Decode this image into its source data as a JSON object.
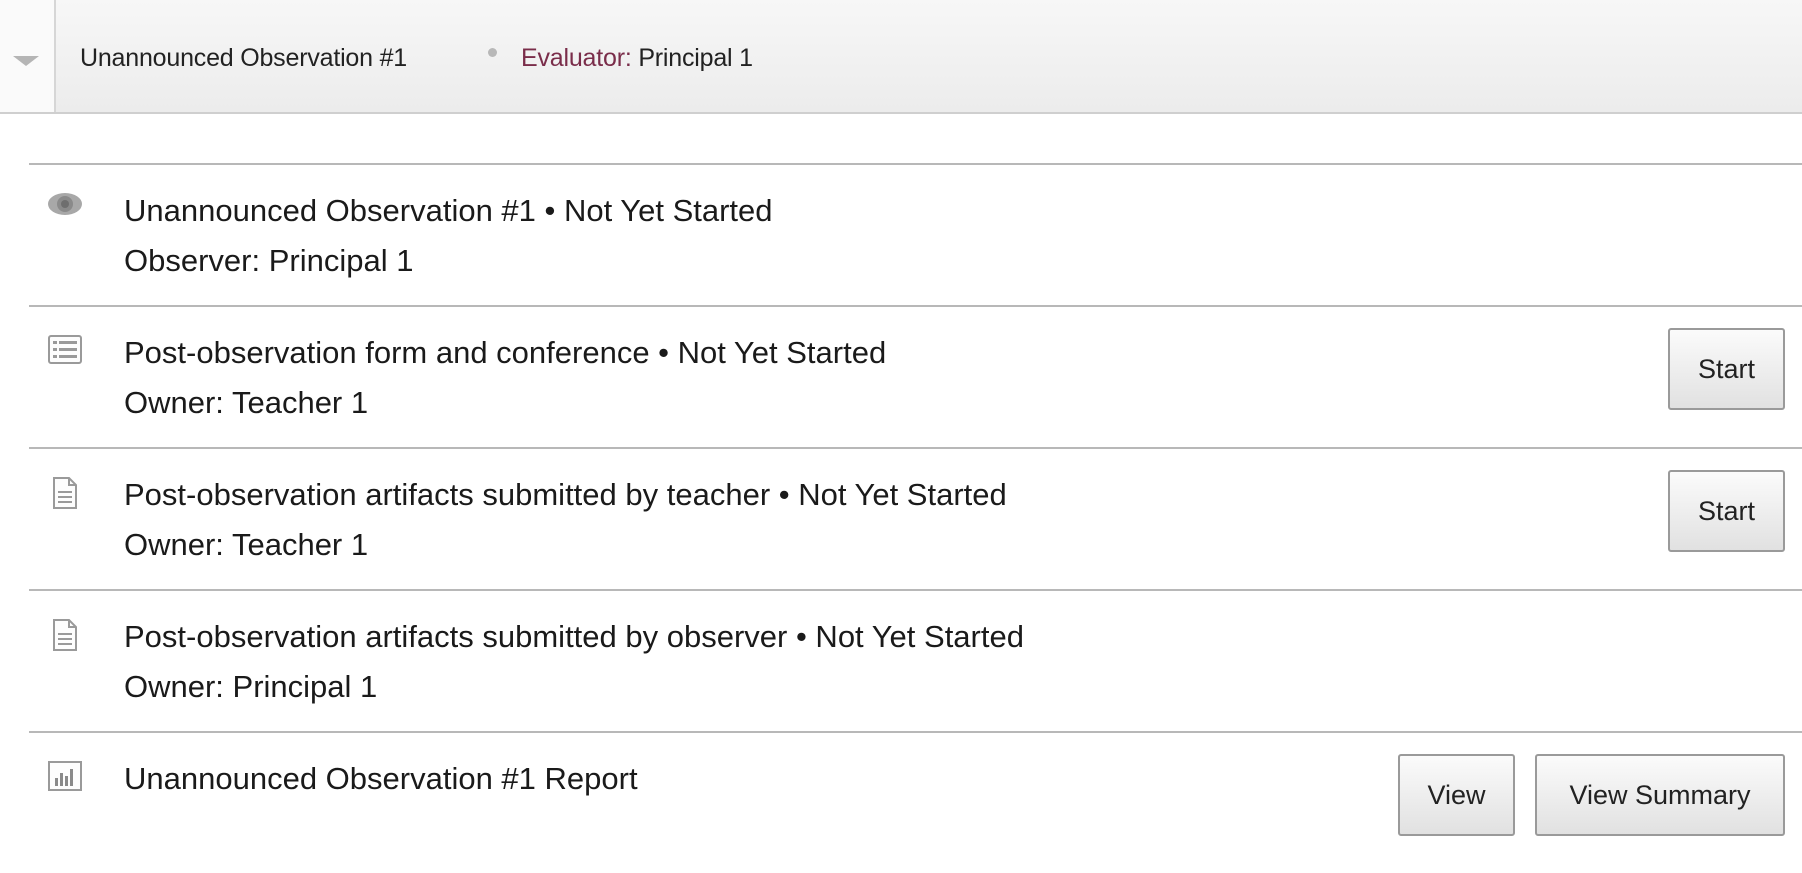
{
  "header": {
    "title": "Unannounced Observation #1",
    "evaluator_label": "Evaluator:",
    "evaluator_value": "Principal 1"
  },
  "rows": [
    {
      "icon": "eye-icon",
      "title": "Unannounced Observation #1 • Not Yet Started",
      "subtitle": "Observer: Principal 1"
    },
    {
      "icon": "form-list-icon",
      "title": "Post-observation form and conference • Not Yet Started",
      "subtitle": "Owner: Teacher 1",
      "button": "Start"
    },
    {
      "icon": "document-icon",
      "title": "Post-observation artifacts submitted by teacher • Not Yet Started",
      "subtitle": "Owner: Teacher 1",
      "button": "Start"
    },
    {
      "icon": "document-icon",
      "title": "Post-observation artifacts submitted by observer • Not Yet Started",
      "subtitle": "Owner: Principal 1"
    },
    {
      "icon": "bar-chart-icon",
      "title": "Unannounced Observation #1 Report",
      "buttons": [
        "View",
        "View Summary"
      ]
    }
  ]
}
